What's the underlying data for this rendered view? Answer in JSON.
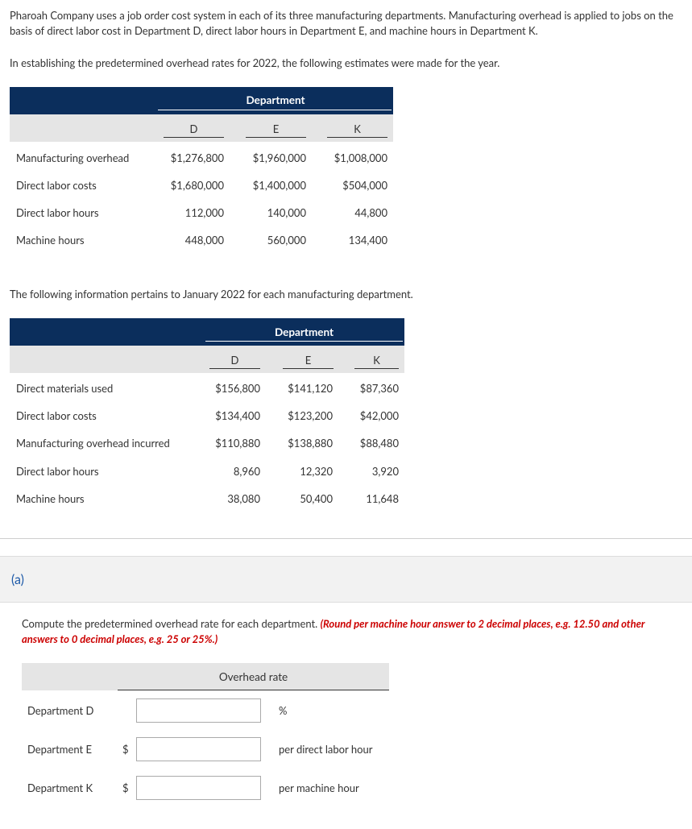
{
  "intro": {
    "paragraph": "Pharoah Company uses a job order cost system in each of its three manufacturing departments. Manufacturing overhead is applied to jobs on the basis of direct labor cost in Department D, direct labor hours in Department E, and machine hours in Department K.",
    "estimates_intro": "In establishing the predetermined overhead rates for 2022, the following estimates were made for the year."
  },
  "table1": {
    "header": "Department",
    "columns": [
      "D",
      "E",
      "K"
    ],
    "rows": [
      {
        "label": "Manufacturing overhead",
        "values": [
          "$1,276,800",
          "$1,960,000",
          "$1,008,000"
        ]
      },
      {
        "label": "Direct labor costs",
        "values": [
          "$1,680,000",
          "$1,400,000",
          "$504,000"
        ]
      },
      {
        "label": "Direct labor hours",
        "values": [
          "112,000",
          "140,000",
          "44,800"
        ]
      },
      {
        "label": "Machine hours",
        "values": [
          "448,000",
          "560,000",
          "134,400"
        ]
      }
    ]
  },
  "january_intro": "The following information pertains to January 2022 for each manufacturing department.",
  "table2": {
    "header": "Department",
    "columns": [
      "D",
      "E",
      "K"
    ],
    "rows": [
      {
        "label": "Direct materials used",
        "values": [
          "$156,800",
          "$141,120",
          "$87,360"
        ]
      },
      {
        "label": "Direct labor costs",
        "values": [
          "$134,400",
          "$123,200",
          "$42,000"
        ]
      },
      {
        "label": "Manufacturing overhead incurred",
        "values": [
          "$110,880",
          "$138,880",
          "$88,480"
        ]
      },
      {
        "label": "Direct labor hours",
        "values": [
          "8,960",
          "12,320",
          "3,920"
        ]
      },
      {
        "label": "Machine hours",
        "values": [
          "38,080",
          "50,400",
          "11,648"
        ]
      }
    ]
  },
  "part": {
    "label": "(a)",
    "instruction": "Compute the predetermined overhead rate for each department.",
    "instruction_note": "(Round per machine hour answer to 2 decimal places, e.g. 12.50 and other answers to 0 decimal places, e.g. 25 or 25%.)"
  },
  "answer_table": {
    "header": "Overhead rate",
    "rows": [
      {
        "label": "Department D",
        "prefix": "",
        "value": "",
        "suffix": "%"
      },
      {
        "label": "Department E",
        "prefix": "$",
        "value": "",
        "suffix": "per direct labor hour"
      },
      {
        "label": "Department K",
        "prefix": "$",
        "value": "",
        "suffix": "per machine hour"
      }
    ]
  }
}
